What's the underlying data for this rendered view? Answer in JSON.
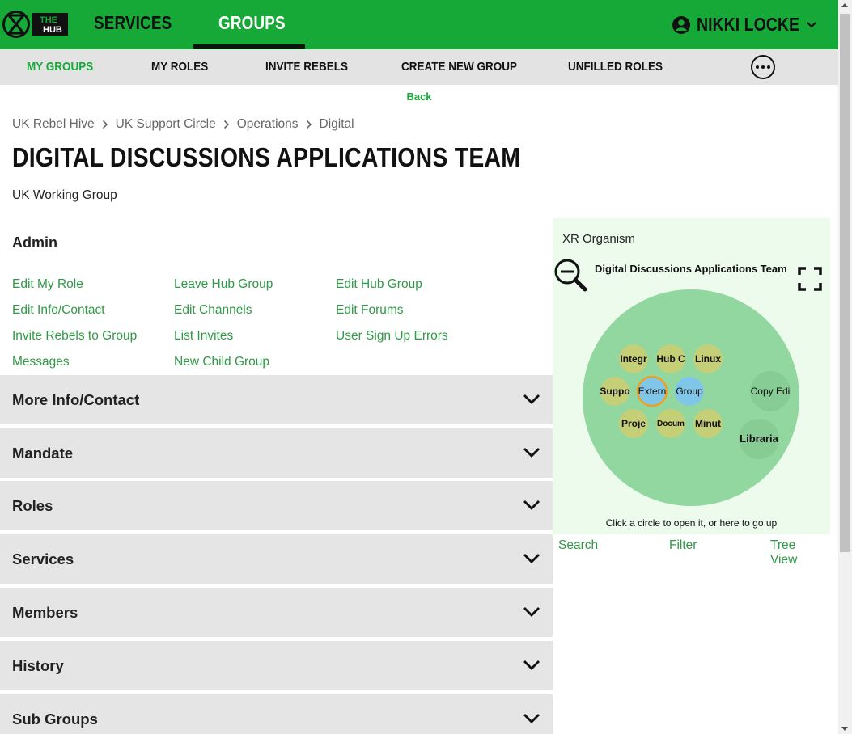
{
  "header": {
    "logo_text": "THE HUB",
    "nav": [
      {
        "label": "SERVICES",
        "active": false
      },
      {
        "label": "GROUPS",
        "active": true
      }
    ],
    "user_name": "NIKKI LOCKE"
  },
  "subnav": {
    "items": [
      {
        "label": "MY GROUPS",
        "active": true
      },
      {
        "label": "MY ROLES",
        "active": false
      },
      {
        "label": "INVITE REBELS",
        "active": false
      },
      {
        "label": "CREATE NEW GROUP",
        "active": false
      },
      {
        "label": "UNFILLED ROLES",
        "active": false
      }
    ],
    "more_icon": "more-horizontal-icon"
  },
  "back_label": "Back",
  "breadcrumb": [
    "UK Rebel Hive",
    "UK Support Circle",
    "Operations",
    "Digital"
  ],
  "page": {
    "title": "DIGITAL DISCUSSIONS APPLICATIONS TEAM",
    "subtitle": "UK Working Group"
  },
  "admin": {
    "title": "Admin",
    "links": [
      [
        "Edit My Role",
        "Leave Hub Group",
        "Edit Hub Group"
      ],
      [
        "Edit Info/Contact",
        "Edit Channels",
        "Edit Forums"
      ],
      [
        "Invite Rebels to Group",
        "List Invites",
        "User Sign Up Errors"
      ],
      [
        "Messages",
        "New Child Group"
      ]
    ]
  },
  "sections": [
    "More Info/Contact",
    "Mandate",
    "Roles",
    "Services",
    "Members",
    "History",
    "Sub Groups"
  ],
  "organism": {
    "title": "XR Organism",
    "group_name": "Digital Discussions Applications Team",
    "hint": "Click a circle to open it, or here to go up",
    "circles": [
      {
        "label": "Integr",
        "kind": "child"
      },
      {
        "label": "Hub C",
        "kind": "child"
      },
      {
        "label": "Linux",
        "kind": "child"
      },
      {
        "label": "Suppo",
        "kind": "child"
      },
      {
        "label": "Extern",
        "kind": "selected"
      },
      {
        "label": "Group",
        "kind": "blue"
      },
      {
        "label": "Proje",
        "kind": "child"
      },
      {
        "label": "Docum",
        "kind": "child"
      },
      {
        "label": "Minut",
        "kind": "child"
      },
      {
        "label": "Copy Edi",
        "kind": "sibling"
      },
      {
        "label": "Libraria",
        "kind": "sibling"
      }
    ],
    "links": [
      "Search",
      "Filter",
      "Tree View"
    ]
  },
  "colors": {
    "brand_green": "#16a938",
    "link_green": "#2f9a45",
    "organism_outer": "#92d7a0",
    "child_circle": "#c5cf78",
    "blue_circle": "#7fc6e8",
    "selected_ring": "#f0a020"
  }
}
